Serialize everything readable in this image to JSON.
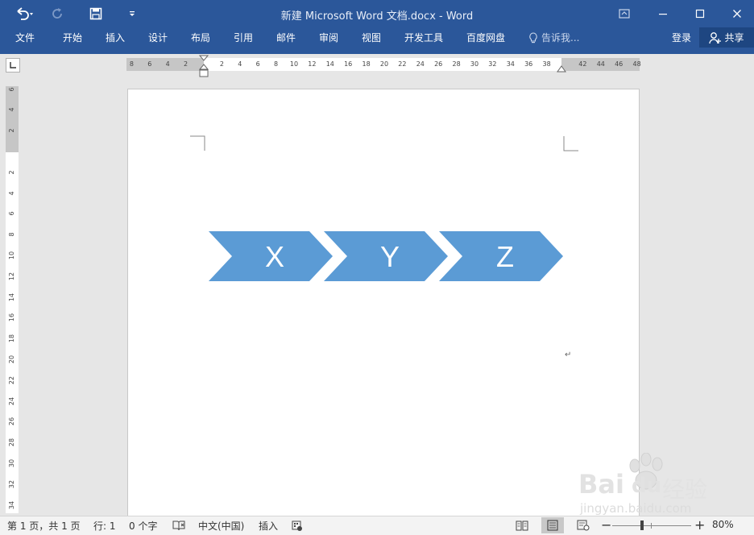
{
  "window": {
    "title": "新建 Microsoft Word 文档.docx - Word"
  },
  "ribbon": {
    "tabs": [
      "文件",
      "开始",
      "插入",
      "设计",
      "布局",
      "引用",
      "邮件",
      "审阅",
      "视图",
      "开发工具",
      "百度网盘"
    ],
    "tell_me": "告诉我...",
    "login": "登录",
    "share": "共享"
  },
  "ruler": {
    "h_left": [
      "8",
      "6",
      "4",
      "2"
    ],
    "h_main": [
      "2",
      "4",
      "6",
      "8",
      "10",
      "12",
      "14",
      "16",
      "18",
      "20",
      "22",
      "24",
      "26",
      "28",
      "30",
      "32",
      "34",
      "36",
      "38"
    ],
    "h_right": [
      "42",
      "44",
      "46",
      "48"
    ],
    "v_top": [
      "6",
      "4",
      "2"
    ],
    "v_main": [
      "2",
      "4",
      "6",
      "8",
      "10",
      "12",
      "14",
      "16",
      "18",
      "20",
      "22",
      "24",
      "26",
      "28",
      "30",
      "32",
      "34"
    ]
  },
  "document": {
    "shapes": [
      {
        "label": "X"
      },
      {
        "label": "Y"
      },
      {
        "label": "Z"
      }
    ],
    "shape_color": "#5b9bd5",
    "paragraph_mark": "↵"
  },
  "status": {
    "page": "第 1 页，共 1 页",
    "line": "行: 1",
    "words": "0 个字",
    "language": "中文(中国)",
    "mode": "插入",
    "zoom": "80%",
    "zoom_value": 0.8
  },
  "watermark": {
    "brand": "Bai",
    "brand2": "du",
    "cn": "经验",
    "url": "jingyan.baidu.com"
  },
  "colors": {
    "ribbon": "#2b579a",
    "share_bg": "#1e4681"
  }
}
